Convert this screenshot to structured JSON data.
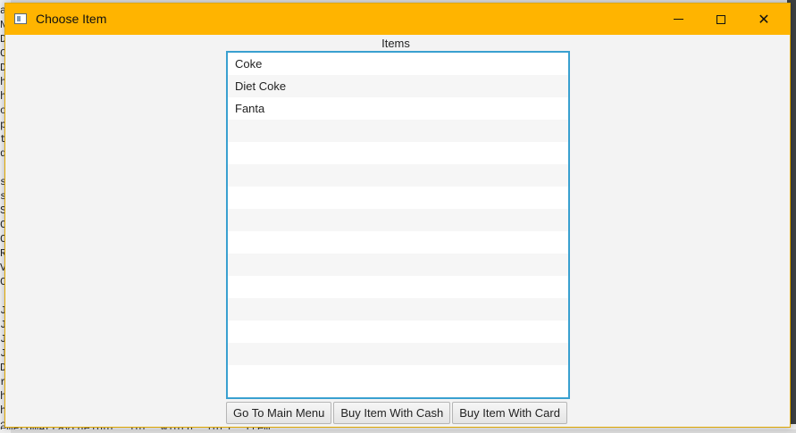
{
  "window": {
    "title": "Choose Item",
    "icon": "app-window-icon",
    "controls": [
      "minimize-icon",
      "maximize-icon",
      "close-icon"
    ],
    "close_glyph": "✕"
  },
  "list": {
    "label": "Items",
    "items": [
      "Coke",
      "Diet Coke",
      "Fanta",
      "",
      "",
      "",
      "",
      "",
      "",
      "",
      "",
      "",
      "",
      "",
      ""
    ],
    "border_color": "#39a0d0"
  },
  "buttons": {
    "main_menu": "Go To Main Menu",
    "buy_cash": "Buy Item With Cash",
    "buy_card": "Buy Item With Card"
  },
  "background": {
    "left_chars": [
      "a",
      "N",
      "D",
      "C",
      "D",
      "h",
      "h",
      "o",
      "p",
      "ti",
      "di",
      "",
      "st",
      "st",
      "S",
      "C",
      "C",
      "R",
      "V",
      "C",
      "",
      "J",
      "J",
      "J",
      "J",
      "D",
      "rt",
      "h",
      "h",
      "e"
    ],
    "bottom_text": "emFromArray(height, int, width, int), Item"
  },
  "colors": {
    "titlebar": "#ffb400",
    "window_bg": "#f3f3f3"
  }
}
